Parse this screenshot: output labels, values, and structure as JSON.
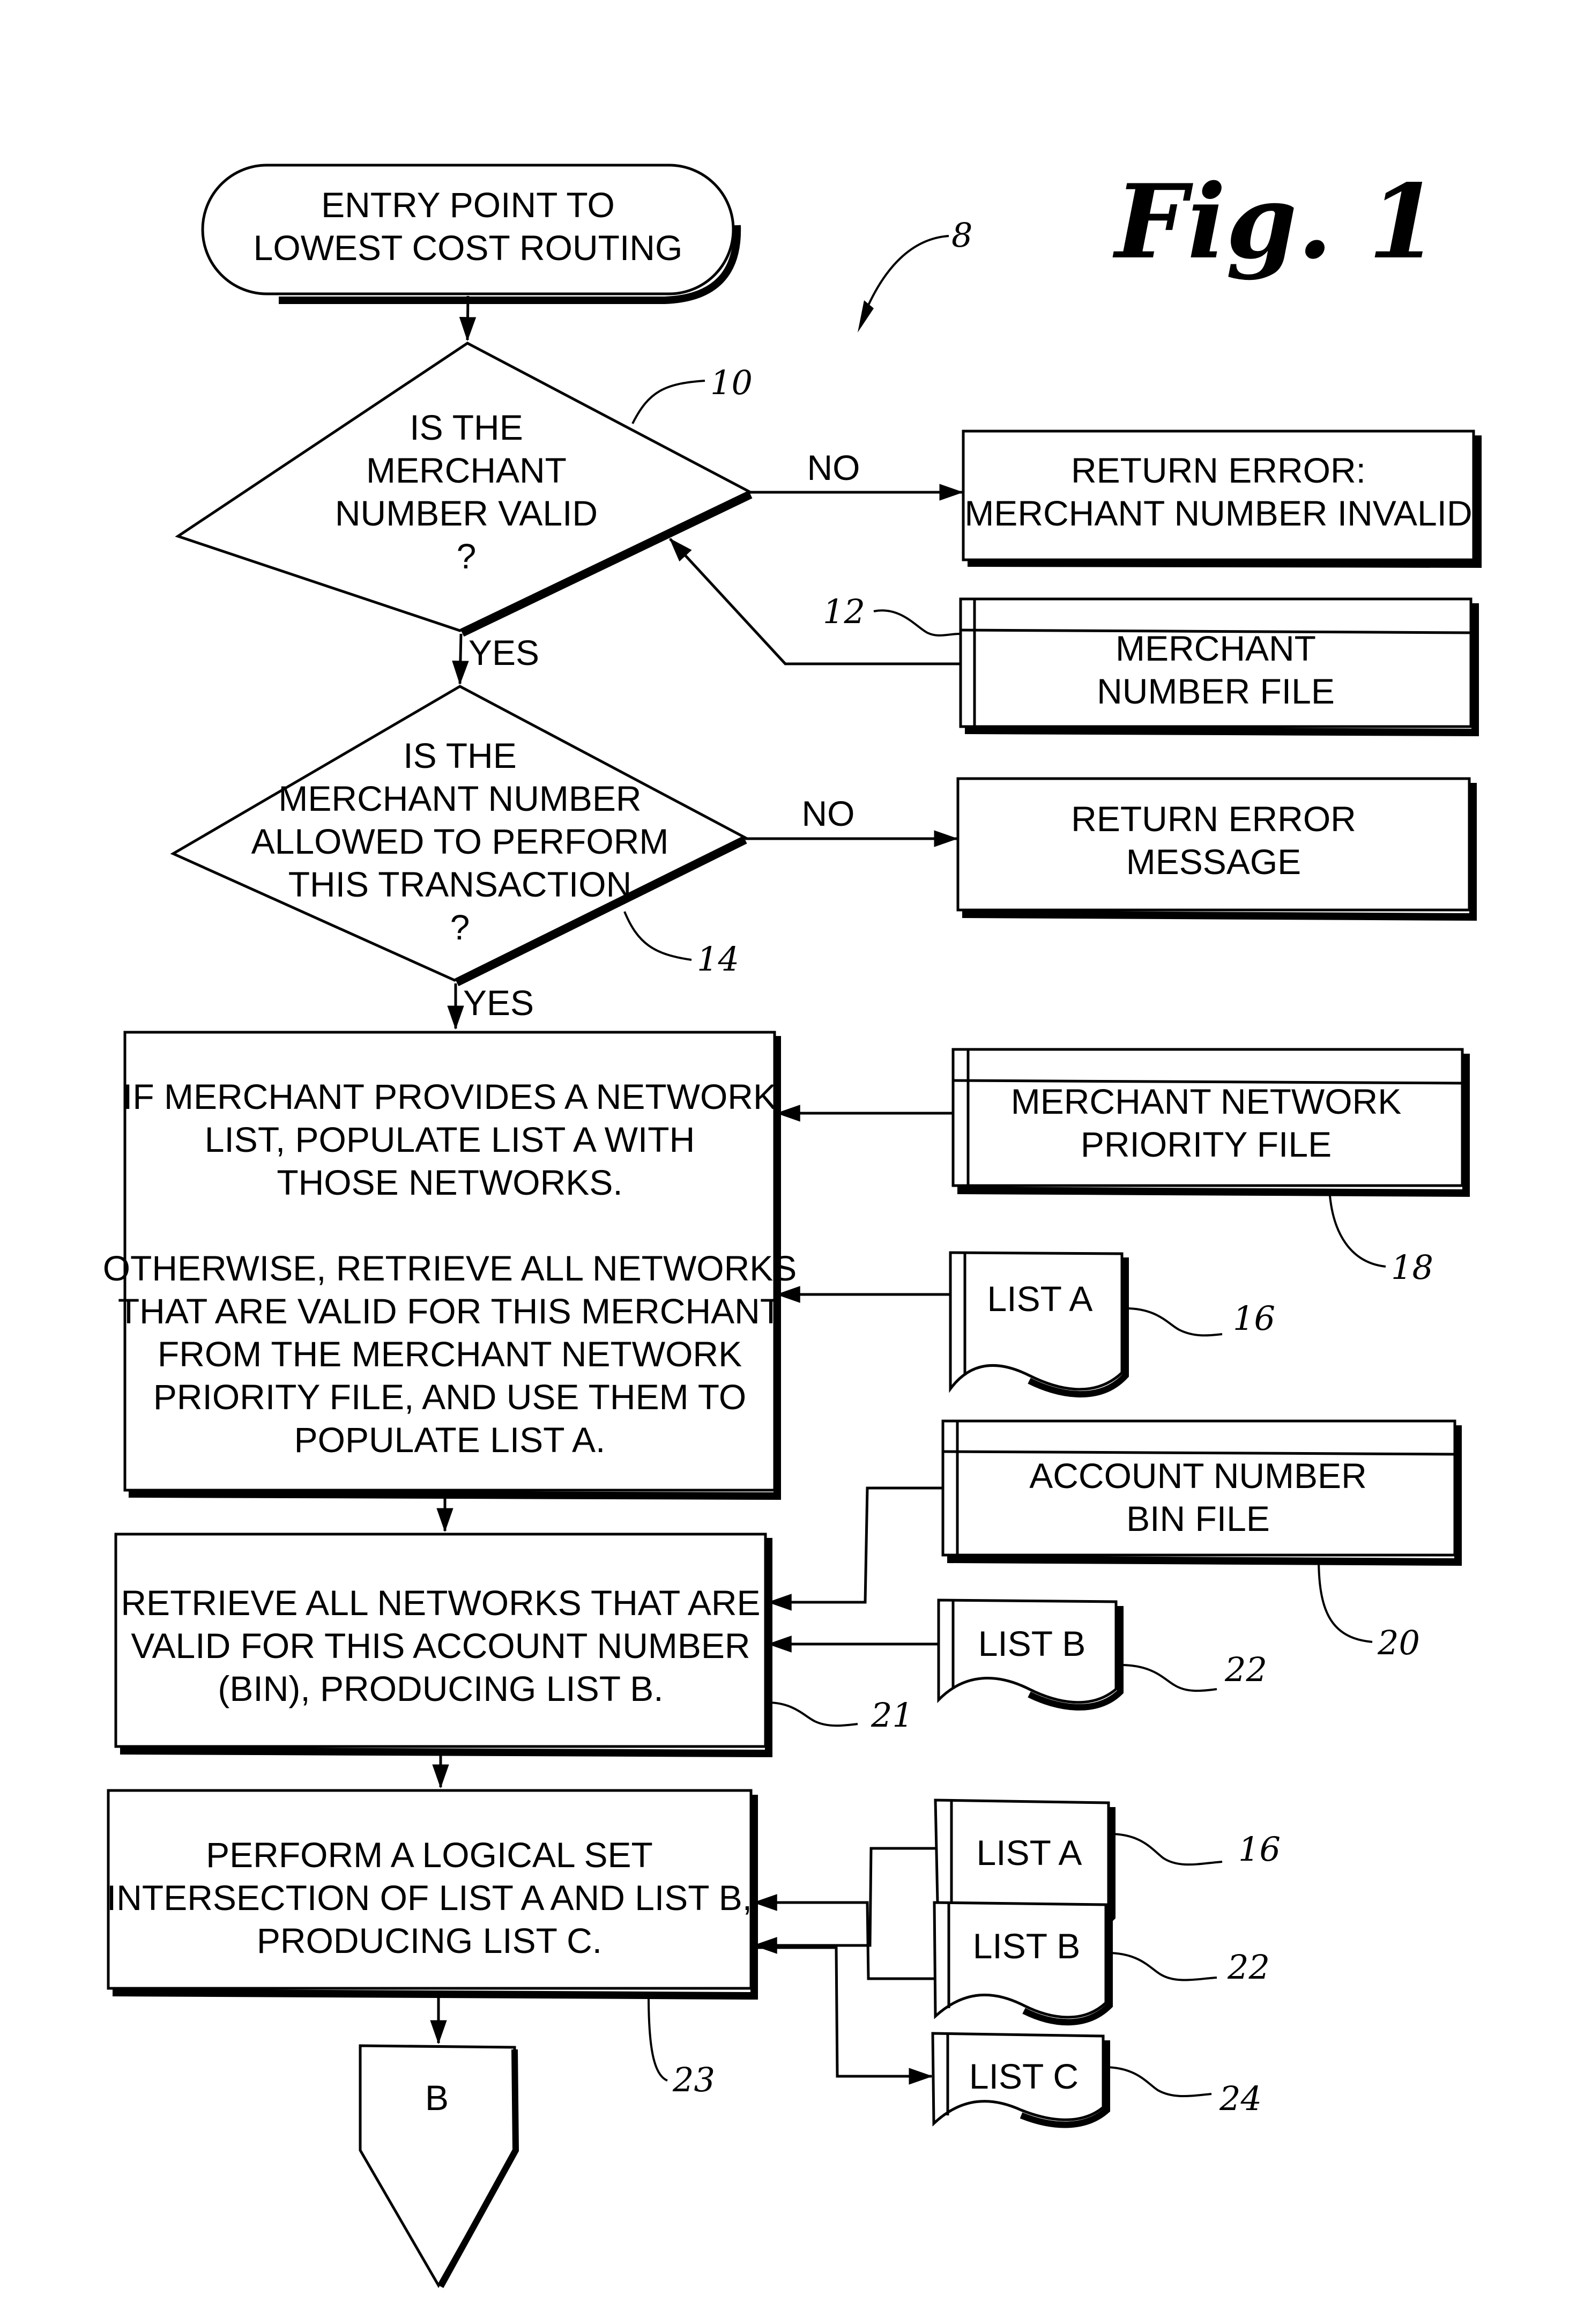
{
  "figure": {
    "title": "Fig. 1",
    "reference": "8"
  },
  "start": {
    "lines": [
      "ENTRY POINT TO",
      "LOWEST COST ROUTING"
    ]
  },
  "decision1": {
    "ref": "10",
    "lines": [
      "IS THE",
      "MERCHANT",
      "NUMBER VALID",
      "?"
    ],
    "no_label": "NO",
    "yes_label": "YES"
  },
  "error1": {
    "lines": [
      "RETURN ERROR:",
      "MERCHANT NUMBER INVALID"
    ]
  },
  "merchant_number_file": {
    "ref": "12",
    "lines": [
      "MERCHANT",
      "NUMBER  FILE"
    ]
  },
  "decision2": {
    "ref": "14",
    "lines": [
      "IS THE",
      "MERCHANT NUMBER",
      "ALLOWED TO PERFORM",
      "THIS TRANSACTION",
      "?"
    ],
    "no_label": "NO",
    "yes_label": "YES"
  },
  "error2": {
    "lines": [
      "RETURN ERROR",
      "MESSAGE"
    ]
  },
  "process_list_a": {
    "lines": [
      "IF MERCHANT PROVIDES A NETWORK",
      "LIST,  POPULATE LIST A WITH",
      "THOSE NETWORKS.",
      "",
      "OTHERWISE, RETRIEVE ALL NETWORKS",
      "THAT ARE VALID FOR THIS MERCHANT",
      "FROM THE MERCHANT NETWORK",
      "PRIORITY FILE, AND USE THEM TO",
      "POPULATE LIST A."
    ]
  },
  "merchant_network_priority_file": {
    "ref": "18",
    "lines": [
      "MERCHANT NETWORK",
      "PRIORITY FILE"
    ]
  },
  "list_a_1": {
    "ref": "16",
    "label": "LIST A"
  },
  "process_list_b": {
    "ref": "21",
    "lines": [
      "RETRIEVE ALL NETWORKS THAT ARE",
      "VALID FOR THIS ACCOUNT NUMBER",
      "(BIN), PRODUCING LIST B."
    ]
  },
  "account_bin_file": {
    "ref": "20",
    "lines": [
      "ACCOUNT NUMBER",
      "BIN FILE"
    ]
  },
  "list_b_1": {
    "ref": "22",
    "label": "LIST B"
  },
  "process_list_c": {
    "ref": "23",
    "lines": [
      "PERFORM A LOGICAL SET",
      "INTERSECTION OF  LIST A AND LIST B,",
      "PRODUCING LIST C."
    ]
  },
  "list_a_2": {
    "ref": "16",
    "label": "LIST A"
  },
  "list_b_2": {
    "ref": "22",
    "label": "LIST B"
  },
  "list_c": {
    "ref": "24",
    "label": "LIST C"
  },
  "connector": {
    "label": "B"
  }
}
